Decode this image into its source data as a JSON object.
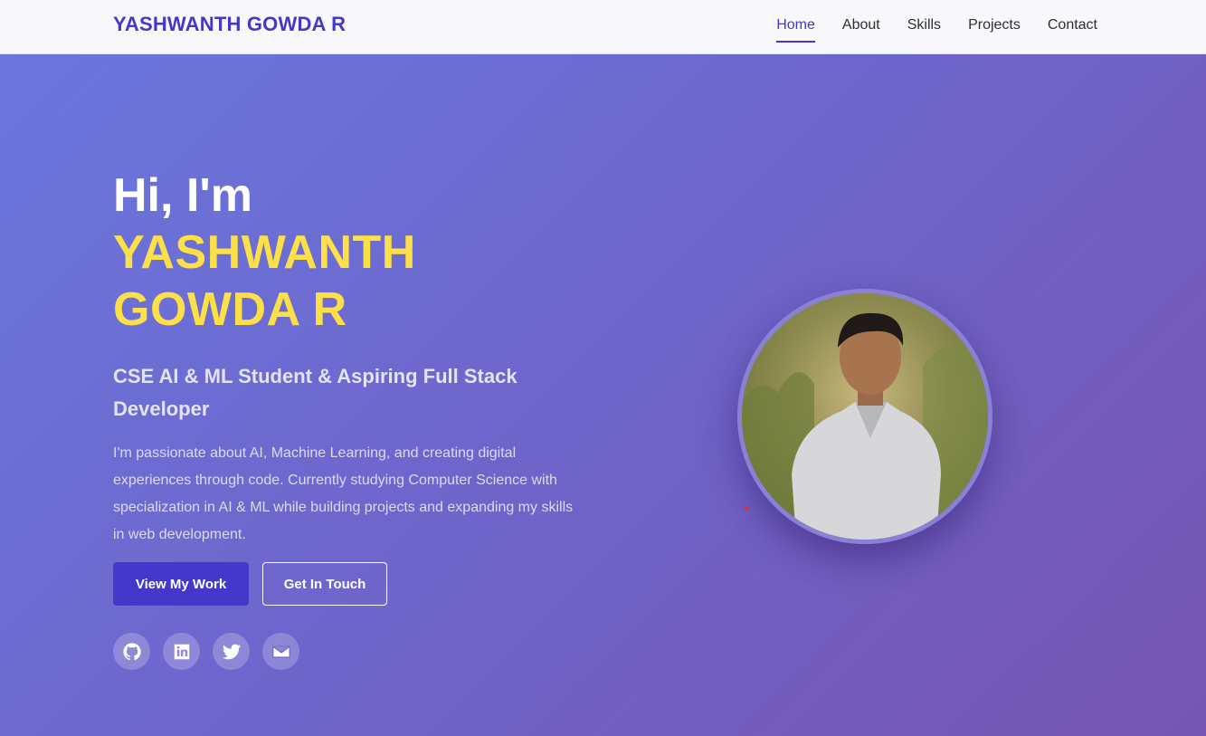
{
  "navbar": {
    "brand": "YASHWANTH GOWDA R",
    "links": [
      {
        "label": "Home",
        "active": true
      },
      {
        "label": "About",
        "active": false
      },
      {
        "label": "Skills",
        "active": false
      },
      {
        "label": "Projects",
        "active": false
      },
      {
        "label": "Contact",
        "active": false
      }
    ]
  },
  "hero": {
    "greeting": "Hi, I'm",
    "name_line1": "YASHWANTH",
    "name_line2": "GOWDA R",
    "tagline": "CSE AI & ML Student & Aspiring Full Stack Developer",
    "description": "I'm passionate about AI, Machine Learning, and creating digital experiences through code. Currently studying Computer Science with specialization in AI & ML while building projects and expanding my skills in web development.",
    "primary_button": "View My Work",
    "secondary_button": "Get In Touch",
    "socials": [
      {
        "icon": "github-icon"
      },
      {
        "icon": "linkedin-icon"
      },
      {
        "icon": "twitter-icon"
      },
      {
        "icon": "email-icon"
      }
    ]
  },
  "colors": {
    "accent": "#4338ca",
    "name_highlight": "#fde047",
    "hero_gradient_start": "#6a77dd",
    "hero_gradient_end": "#7656b2"
  }
}
